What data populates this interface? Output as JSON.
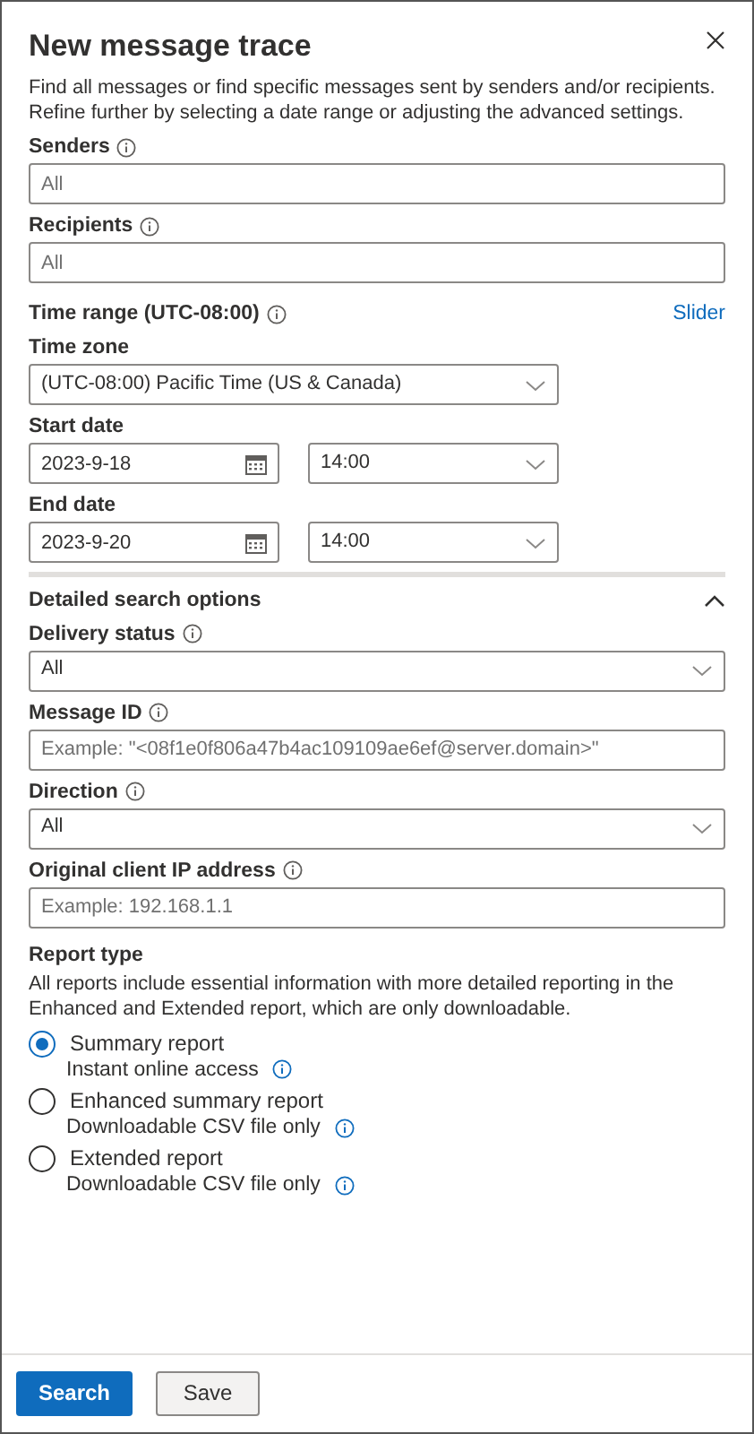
{
  "panel": {
    "title": "New message trace",
    "description": "Find all messages or find specific messages sent by senders and/or recipients. Refine further by selecting a date range or adjusting the advanced settings."
  },
  "fields": [
    {
      "kind": "input",
      "label": "Senders",
      "info": true,
      "placeholder": "All"
    },
    {
      "kind": "input",
      "label": "Recipients",
      "info": true,
      "placeholder": "All"
    },
    {
      "kind": "heading",
      "label": "Time range (UTC-08:00)",
      "info": true,
      "link": "Slider"
    },
    {
      "kind": "picker",
      "label": "Time zone",
      "info": false,
      "value": "(UTC-08:00) Pacific Time (US & Canada)"
    },
    {
      "kind": "datetime",
      "label": "Start date",
      "info": false,
      "date": "2023-9-18",
      "time": "14:00"
    },
    {
      "kind": "datetime",
      "label": "End date",
      "info": false,
      "date": "2023-9-20",
      "time": "14:00"
    }
  ],
  "detailed": {
    "title": "Detailed search options",
    "expanded": true,
    "fields": [
      {
        "kind": "select",
        "label": "Delivery status",
        "info": true,
        "value": "All"
      },
      {
        "kind": "input",
        "label": "Message ID",
        "info": true,
        "placeholder": "Example: \"<08f1e0f806a47b4ac109109ae6ef@server.domain>\""
      },
      {
        "kind": "select",
        "label": "Direction",
        "info": true,
        "value": "All"
      },
      {
        "kind": "input",
        "label": "Original client IP address",
        "info": true,
        "placeholder": "Example: 192.168.1.1"
      }
    ]
  },
  "report_type": {
    "title": "Report type",
    "description": "All reports include essential information with more detailed reporting in the Enhanced and Extended report, which are only downloadable.",
    "options": [
      {
        "label": "Summary report",
        "sublabel": "Instant online access",
        "selected": true
      },
      {
        "label": "Enhanced summary report",
        "sublabel": "Downloadable CSV file only",
        "selected": false
      },
      {
        "label": "Extended report",
        "sublabel": "Downloadable CSV file only",
        "selected": false
      }
    ]
  },
  "buttons": [
    {
      "label": "Search",
      "kind": "primary"
    },
    {
      "label": "Save",
      "kind": "default"
    }
  ]
}
